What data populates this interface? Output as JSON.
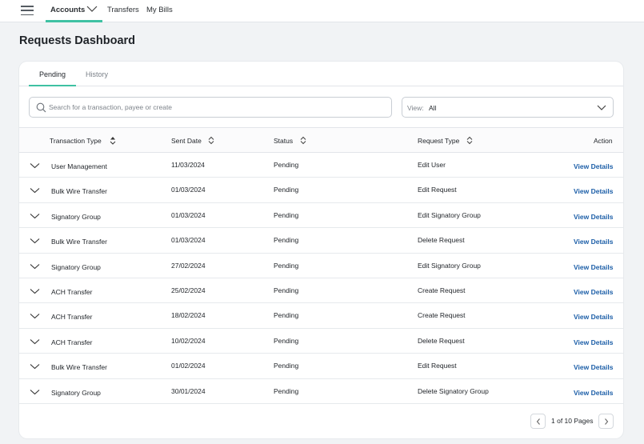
{
  "nav": {
    "menu_icon": "hamburger-icon",
    "items": [
      "Accounts",
      "Transfers",
      "My Bills"
    ],
    "accent_color": "#3fc1a3"
  },
  "page": {
    "title": "Requests Dashboard"
  },
  "tabs": [
    "Pending",
    "History"
  ],
  "search": {
    "placeholder": "Search for a transaction, payee or create",
    "value": ""
  },
  "view": {
    "label": "View:",
    "value": "All"
  },
  "table": {
    "columns": [
      "Transaction Type",
      "Sent Date",
      "Status",
      "Request Type",
      "Action"
    ],
    "rows": [
      {
        "type": "User Management",
        "date": "11/03/2024",
        "status": "Pending",
        "request": "Edit User",
        "action": "View Details"
      },
      {
        "type": "Bulk Wire Transfer",
        "date": "01/03/2024",
        "status": "Pending",
        "request": "Edit Request",
        "action": "View Details"
      },
      {
        "type": "Signatory Group",
        "date": "01/03/2024",
        "status": "Pending",
        "request": "Edit Signatory Group",
        "action": "View Details"
      },
      {
        "type": "Bulk Wire Transfer",
        "date": "01/03/2024",
        "status": "Pending",
        "request": "Delete Request",
        "action": "View Details"
      },
      {
        "type": "Signatory Group",
        "date": "27/02/2024",
        "status": "Pending",
        "request": "Edit Signatory Group",
        "action": "View Details"
      },
      {
        "type": "ACH Transfer",
        "date": "25/02/2024",
        "status": "Pending",
        "request": "Create Request",
        "action": "View Details"
      },
      {
        "type": "ACH Transfer",
        "date": "18/02/2024",
        "status": "Pending",
        "request": "Create Request",
        "action": "View Details"
      },
      {
        "type": "ACH Transfer",
        "date": "10/02/2024",
        "status": "Pending",
        "request": "Delete Request",
        "action": "View Details"
      },
      {
        "type": "Bulk Wire Transfer",
        "date": "01/02/2024",
        "status": "Pending",
        "request": "Edit Request",
        "action": "View Details"
      },
      {
        "type": "Signatory Group",
        "date": "30/01/2024",
        "status": "Pending",
        "request": "Delete Signatory Group",
        "action": "View Details"
      }
    ]
  },
  "pagination": {
    "label": "1 of 10 Pages"
  }
}
